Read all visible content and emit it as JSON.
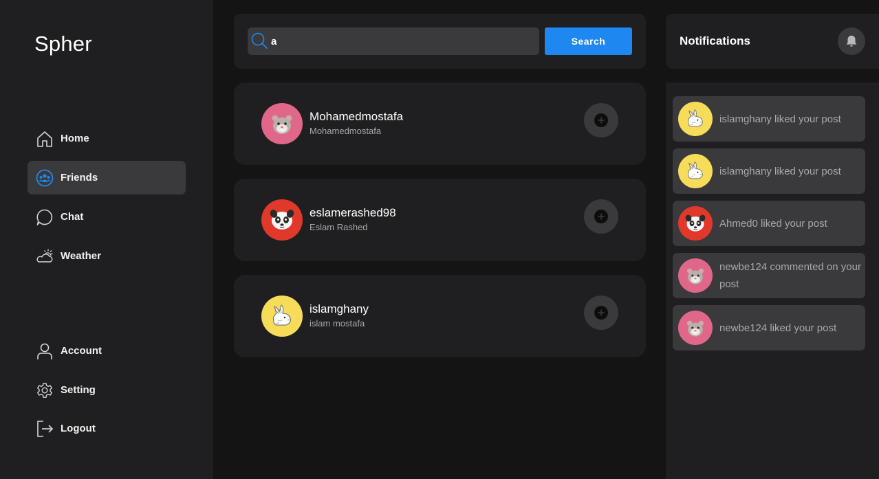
{
  "app": {
    "name": "Spher"
  },
  "sidebar": {
    "nav": [
      {
        "label": "Home",
        "icon": "home-icon"
      },
      {
        "label": "Friends",
        "icon": "friends-icon",
        "active": true
      },
      {
        "label": "Chat",
        "icon": "chat-icon"
      },
      {
        "label": "Weather",
        "icon": "weather-icon"
      }
    ],
    "bottom": [
      {
        "label": "Account",
        "icon": "user-icon"
      },
      {
        "label": "Setting",
        "icon": "gear-icon"
      },
      {
        "label": "Logout",
        "icon": "logout-icon"
      }
    ]
  },
  "search": {
    "value": "a",
    "button_label": "Search"
  },
  "friends": [
    {
      "username": "Mohamedmostafa",
      "display_name": "Mohamedmostafa",
      "avatar": "hamster-avatar",
      "avatar_color": "#e0678a"
    },
    {
      "username": "eslamerashed98",
      "display_name": "Eslam Rashed",
      "avatar": "panda-avatar",
      "avatar_color": "#e0382a"
    },
    {
      "username": "islamghany",
      "display_name": "islam mostafa",
      "avatar": "rabbit-avatar",
      "avatar_color": "#f7dc5a"
    }
  ],
  "notifications": {
    "title": "Notifications",
    "items": [
      {
        "text": "islamghany liked your post",
        "avatar": "rabbit-avatar",
        "avatar_color": "#f7dc5a"
      },
      {
        "text": "islamghany liked your post",
        "avatar": "rabbit-avatar",
        "avatar_color": "#f7dc5a"
      },
      {
        "text": "Ahmed0 liked your post",
        "avatar": "panda-avatar",
        "avatar_color": "#e0382a"
      },
      {
        "text": "newbe124 commented on your post",
        "avatar": "hamster-avatar",
        "avatar_color": "#e0678a"
      },
      {
        "text": "newbe124 liked your post",
        "avatar": "hamster-avatar",
        "avatar_color": "#e0678a"
      }
    ]
  },
  "colors": {
    "accent": "#1e88f0",
    "sidebar_bg": "#1f1f21",
    "page_bg": "#141415",
    "active_bg": "#3a3a3d"
  }
}
